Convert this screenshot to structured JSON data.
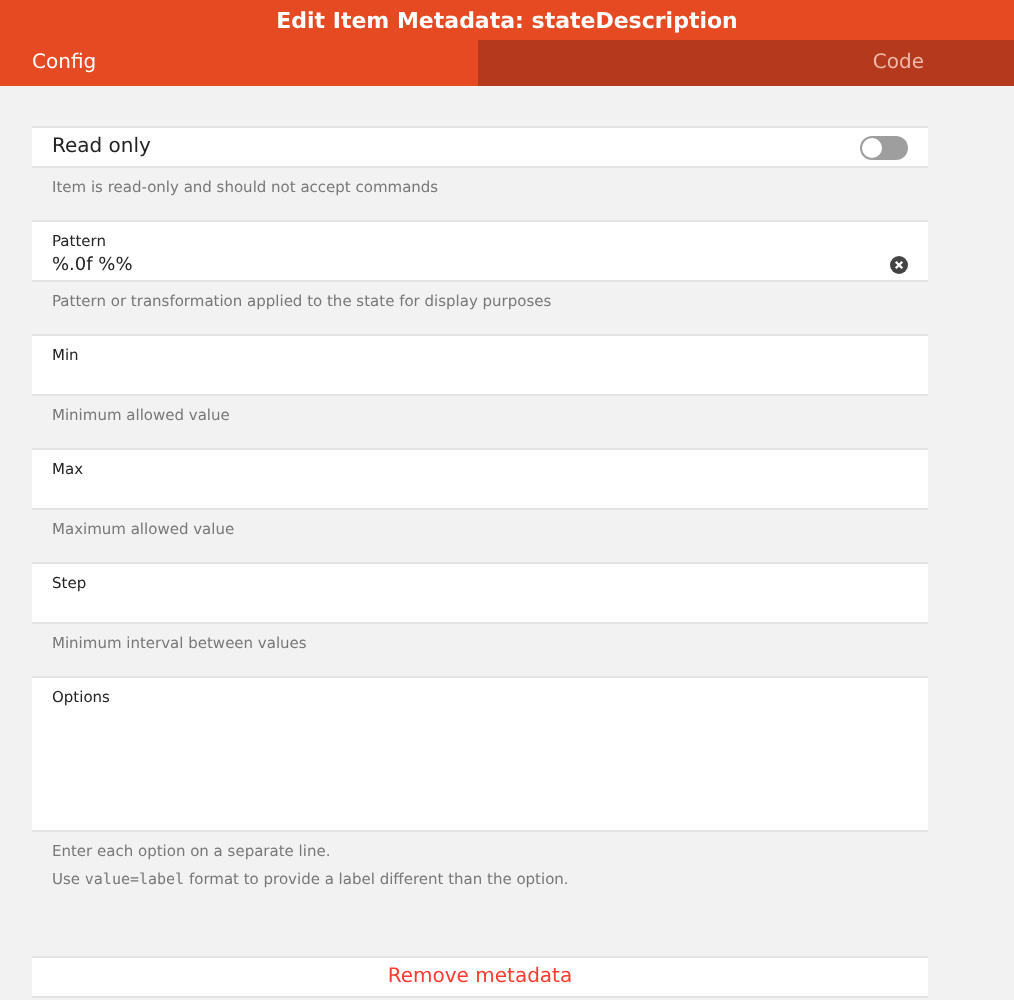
{
  "window": {
    "title": "Edit Item Metadata: stateDescription"
  },
  "tabs": [
    {
      "label": "Config",
      "selected": true
    },
    {
      "label": "Code",
      "selected": false
    }
  ],
  "fields": [
    {
      "kind": "toggle",
      "label": "Read only",
      "on": false,
      "hint": [
        "Item is read-only and should not accept commands"
      ]
    },
    {
      "kind": "text",
      "label": "Pattern",
      "value": "%.0f %%",
      "hint": [
        "Pattern or transformation applied to the state for display purposes"
      ]
    },
    {
      "kind": "text",
      "label": "Min",
      "hint": [
        "Minimum allowed value"
      ]
    },
    {
      "kind": "text",
      "label": "Max",
      "hint": [
        "Maximum allowed value"
      ]
    },
    {
      "kind": "text",
      "label": "Step",
      "hint": [
        "Minimum interval between values"
      ]
    },
    {
      "kind": "textarea",
      "label": "Options",
      "hint": [
        "Enter each option on a separate line.",
        [
          {
            "text": "Use "
          },
          {
            "text": "value=label",
            "kind": "code"
          },
          {
            "text": " format to provide a label different than the option."
          }
        ]
      ]
    }
  ],
  "remove_button": "Remove metadata"
}
